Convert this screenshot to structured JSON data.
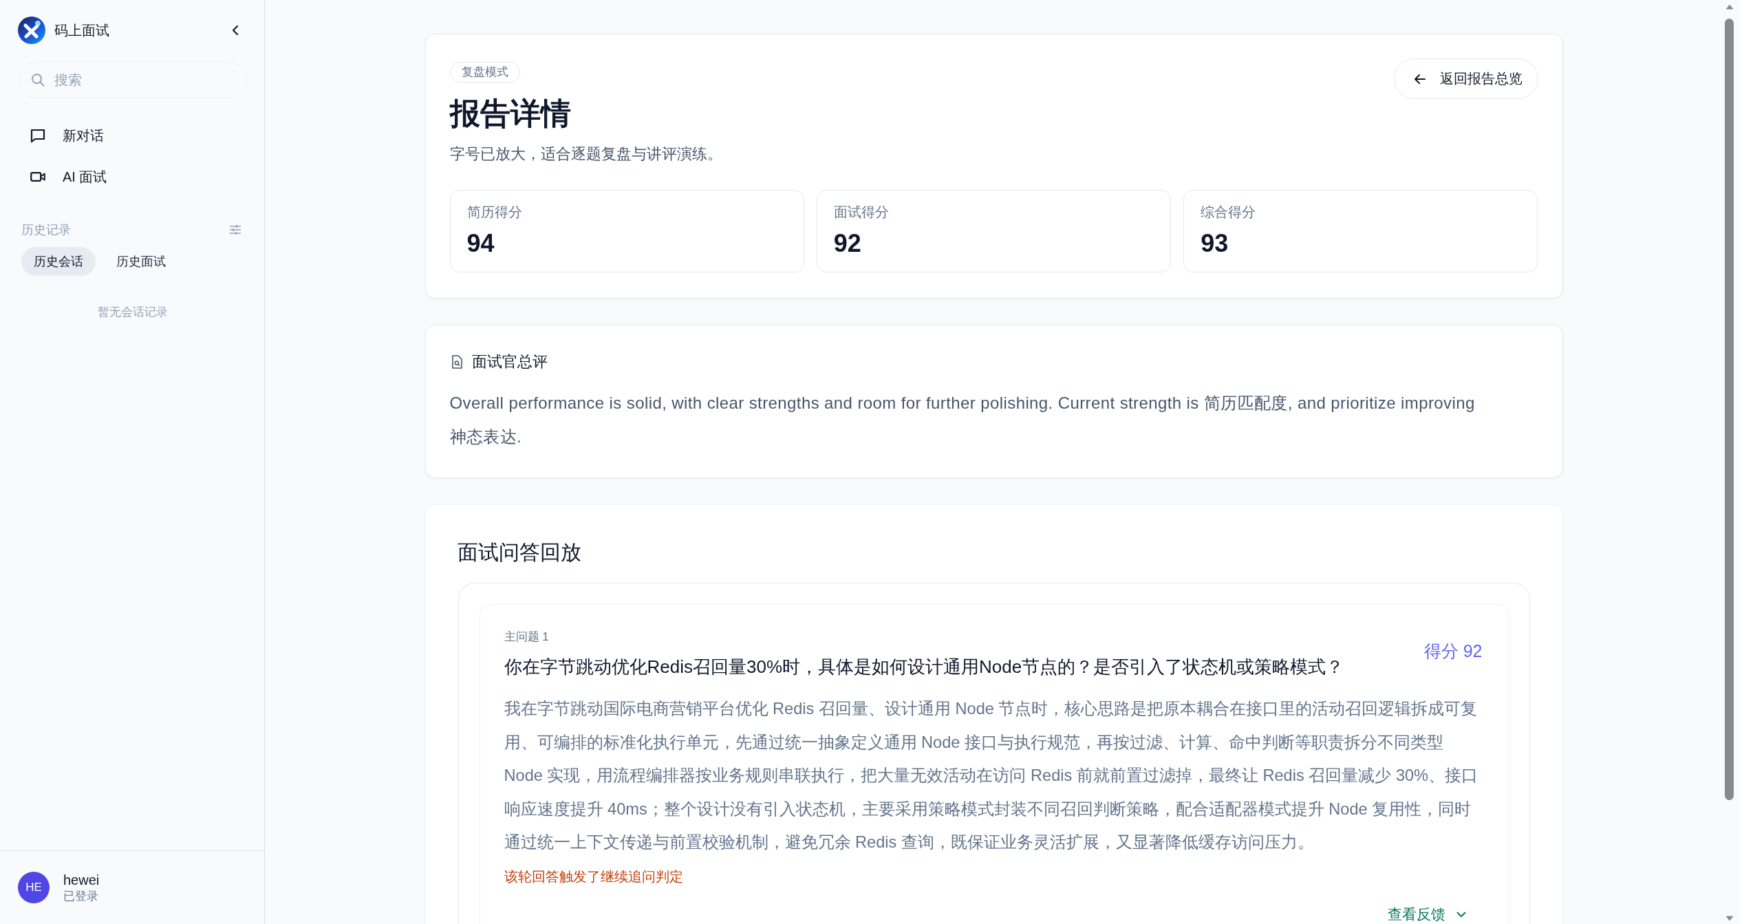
{
  "sidebar": {
    "brand": "码上面试",
    "search": {
      "placeholder": "搜索"
    },
    "nav": [
      {
        "label": "新对话"
      },
      {
        "label": "AI 面试"
      }
    ],
    "history": {
      "title": "历史记录",
      "tabs": [
        {
          "label": "历史会话",
          "selected": true
        },
        {
          "label": "历史面试",
          "selected": false
        }
      ],
      "empty_text": "暂无会话记录"
    },
    "user": {
      "initials": "HE",
      "name": "hewei",
      "status": "已登录"
    }
  },
  "report": {
    "badge": "复盘模式",
    "title": "报告详情",
    "subtitle": "字号已放大，适合逐题复盘与讲评演练。",
    "back_button": "返回报告总览",
    "scores": [
      {
        "label": "简历得分",
        "value": "94"
      },
      {
        "label": "面试得分",
        "value": "92"
      },
      {
        "label": "综合得分",
        "value": "93"
      }
    ]
  },
  "summary": {
    "title": "面试官总评",
    "text": "Overall performance is solid, with clear strengths and room for further polishing. Current strength is 简历匹配度, and prioritize improving 神态表达."
  },
  "replay": {
    "title": "面试问答回放",
    "items": [
      {
        "tag": "主问题 1",
        "question": "你在字节跳动优化Redis召回量30%时，具体是如何设计通用Node节点的？是否引入了状态机或策略模式？",
        "score": "得分 92",
        "answer": "我在字节跳动国际电商营销平台优化 Redis 召回量、设计通用 Node 节点时，核心思路是把原本耦合在接口里的活动召回逻辑拆成可复用、可编排的标准化执行单元，先通过统一抽象定义通用 Node 接口与执行规范，再按过滤、计算、命中判断等职责拆分不同类型 Node 实现，用流程编排器按业务规则串联执行，把大量无效活动在访问 Redis 前就前置过滤掉，最终让 Redis 召回量减少 30%、接口响应速度提升 40ms；整个设计没有引入状态机，主要采用策略模式封装不同召回判断策略，配合适配器模式提升 Node 复用性，同时通过统一上下文传递与前置校验机制，避免冗余 Redis 查询，既保证业务灵活扩展，又显著降低缓存访问压力。",
        "note": "该轮回答触发了继续追问判定",
        "feedback_toggle": {
          "label": "查看反馈",
          "expanded": false
        }
      }
    ]
  }
}
